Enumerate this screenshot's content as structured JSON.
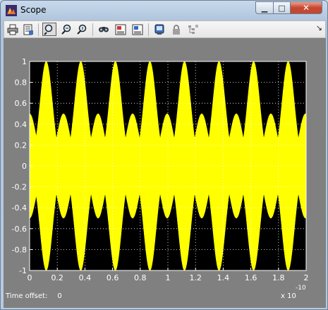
{
  "window": {
    "title": "Scope",
    "minimize_glyph": "▁",
    "maximize_glyph": "□",
    "close_glyph": "✕"
  },
  "toolbar": {
    "buttons": [
      {
        "icon": "print-icon",
        "label": "Print"
      },
      {
        "icon": "parameters-icon",
        "label": "Parameters"
      },
      {
        "icon": "zoom-icon",
        "label": "Zoom",
        "active": true
      },
      {
        "icon": "zoom-x-icon",
        "label": "Zoom X-axis"
      },
      {
        "icon": "zoom-y-icon",
        "label": "Zoom Y-axis"
      },
      {
        "icon": "autoscale-icon",
        "label": "Autoscale"
      },
      {
        "icon": "save-axes-icon",
        "label": "Save axes settings"
      },
      {
        "icon": "restore-axes-icon",
        "label": "Restore saved axes settings"
      },
      {
        "icon": "floating-scope-icon",
        "label": "Floating scope"
      },
      {
        "icon": "lock-icon",
        "label": "Lock/Unlock axes selection"
      },
      {
        "icon": "signal-selection-icon",
        "label": "Signal selection"
      }
    ],
    "dock_glyph": "↘"
  },
  "status": {
    "time_offset_label": "Time offset:",
    "time_offset_value": "0"
  },
  "colors": {
    "plot_background": "#000000",
    "panel_background": "#808080",
    "signal": "#ffff00",
    "grid": "#ffffff"
  },
  "chart_data": {
    "type": "area",
    "description_of_signal": "AM-modulated high-frequency carrier, envelope alternating tall (~1.0) and short (~0.5) lobes",
    "x_range": [
      0,
      2e-10
    ],
    "y_range": [
      -1,
      1
    ],
    "x_ticks": [
      "0",
      "0.2",
      "0.4",
      "0.6",
      "0.8",
      "1",
      "1.2",
      "1.4",
      "1.6",
      "1.8",
      "2"
    ],
    "y_ticks": [
      "1",
      "0.8",
      "0.6",
      "0.4",
      "0.2",
      "0",
      "-0.2",
      "-0.4",
      "-0.6",
      "-0.8",
      "-1"
    ],
    "x_multiplier_base": "x 10",
    "x_multiplier_exponent": "-10",
    "grid": true,
    "envelope_lobes": [
      {
        "center": 0.0,
        "peak": 0.5
      },
      {
        "center": 0.12,
        "peak": 1.0
      },
      {
        "center": 0.245,
        "peak": 0.5
      },
      {
        "center": 0.37,
        "peak": 1.0
      },
      {
        "center": 0.495,
        "peak": 0.5
      },
      {
        "center": 0.62,
        "peak": 1.0
      },
      {
        "center": 0.745,
        "peak": 0.5
      },
      {
        "center": 0.87,
        "peak": 1.0
      },
      {
        "center": 0.995,
        "peak": 0.5
      },
      {
        "center": 1.12,
        "peak": 1.0
      },
      {
        "center": 1.245,
        "peak": 0.5
      },
      {
        "center": 1.37,
        "peak": 1.0
      },
      {
        "center": 1.495,
        "peak": 0.5
      },
      {
        "center": 1.62,
        "peak": 1.0
      },
      {
        "center": 1.745,
        "peak": 0.5
      },
      {
        "center": 1.87,
        "peak": 1.0
      },
      {
        "center": 1.995,
        "peak": 0.5
      }
    ],
    "baseline_amplitude": 0.05
  }
}
